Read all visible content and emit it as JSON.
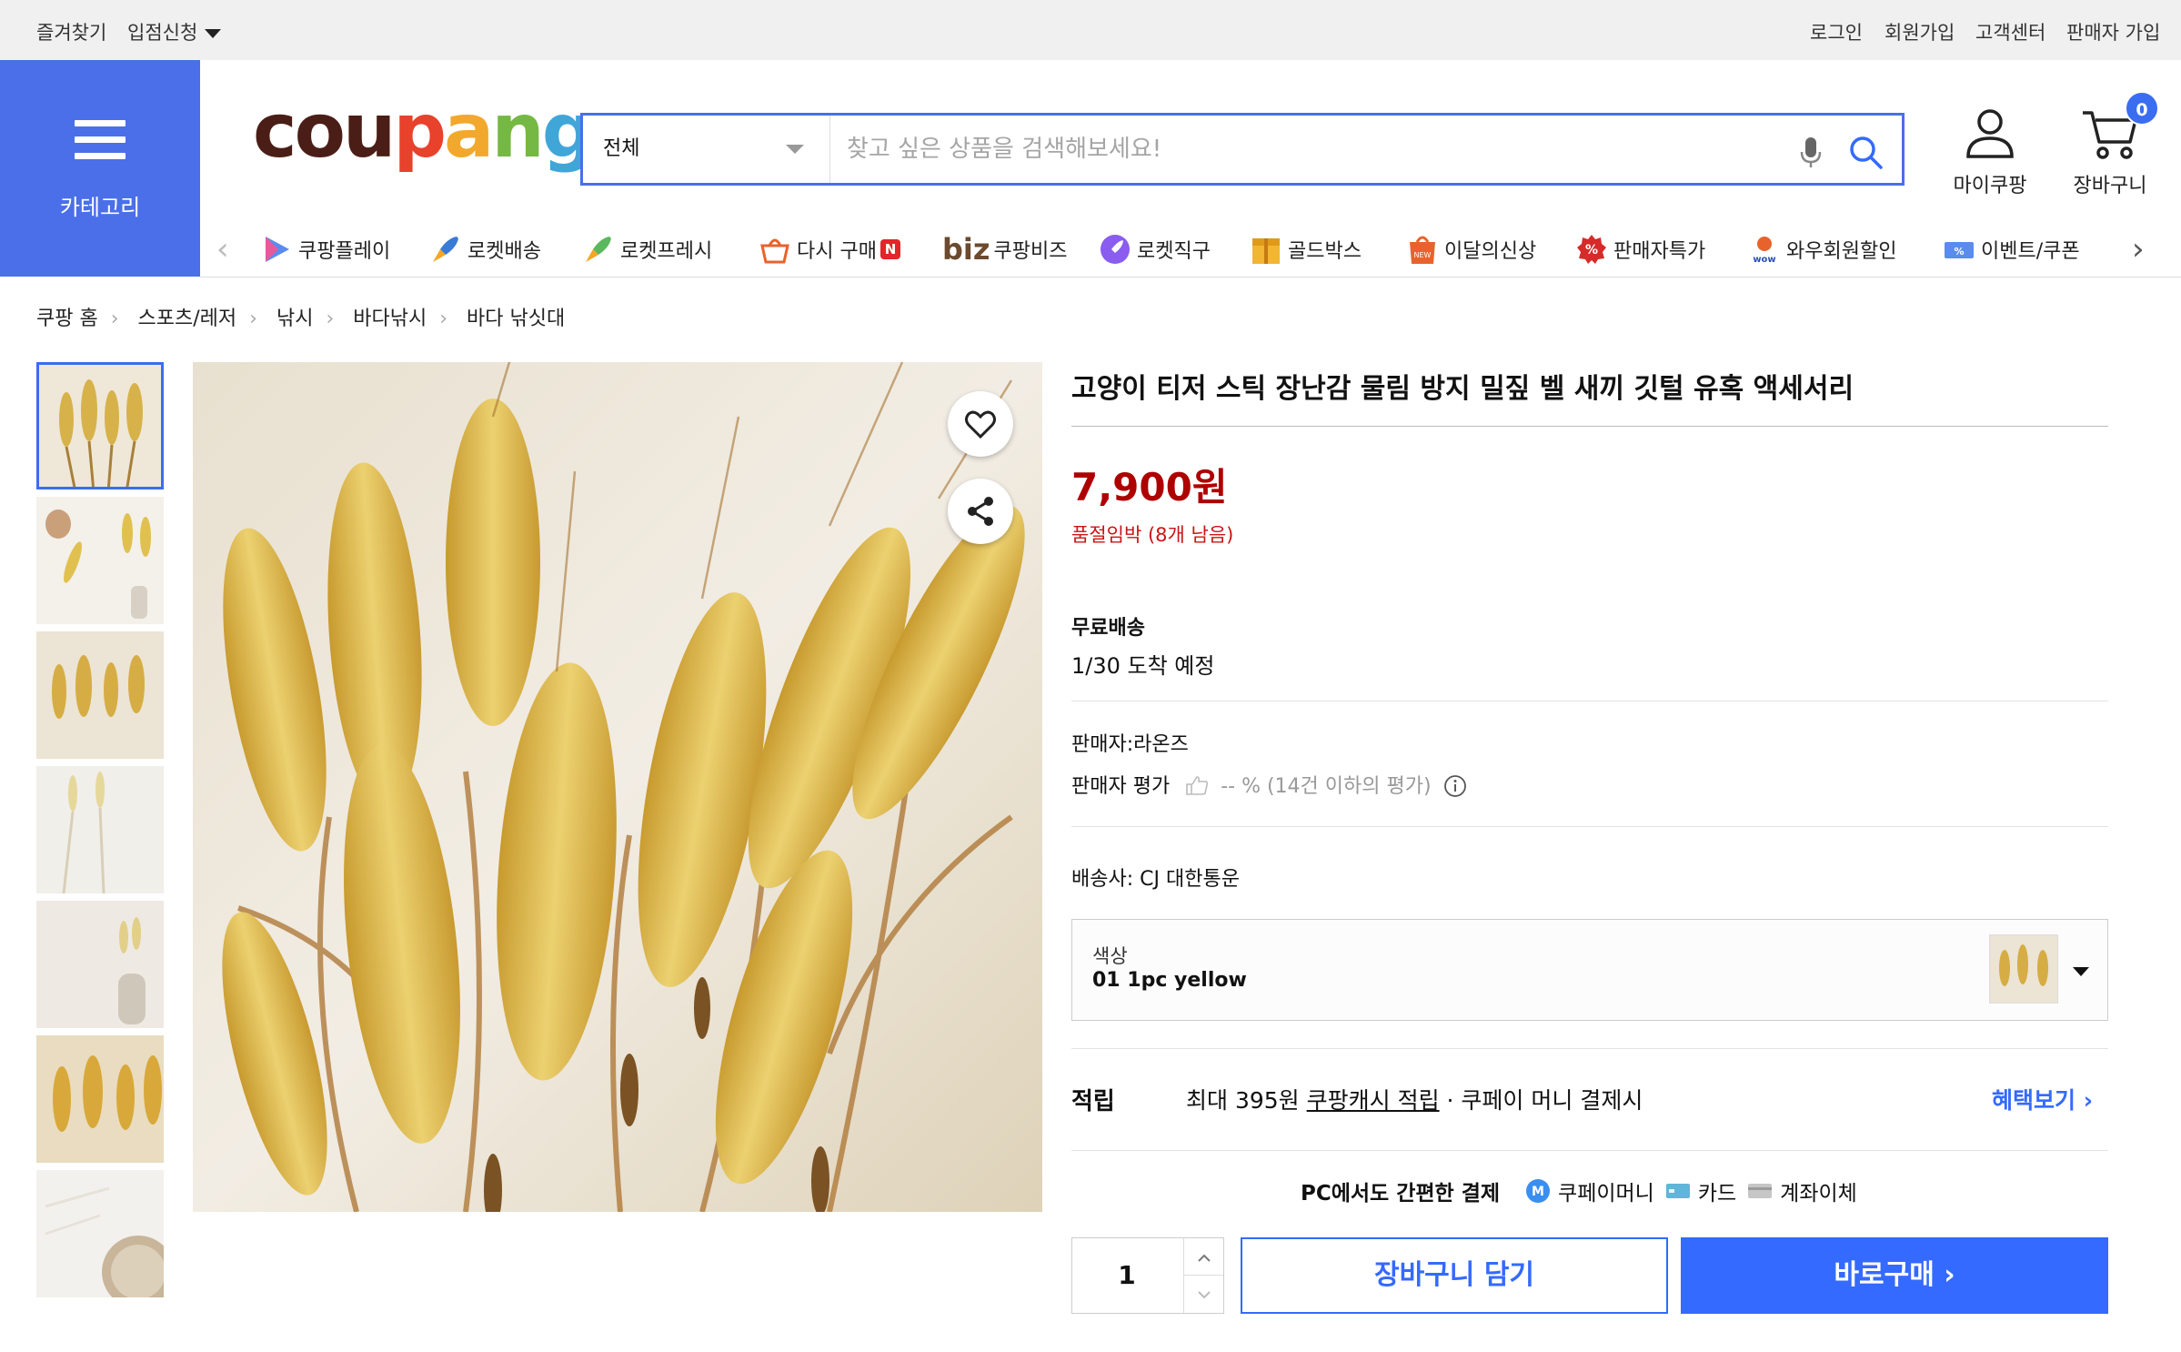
{
  "topbar": {
    "favorites": "즐겨찾기",
    "partner": "입점신청",
    "login": "로그인",
    "signup": "회원가입",
    "support": "고객센터",
    "seller_signup": "판매자 가입"
  },
  "header": {
    "category_label": "카테고리",
    "logo": {
      "p1": "cou",
      "p2": "p",
      "p3": "a",
      "p4": "n",
      "p5": "g"
    },
    "search_category": "전체",
    "search_placeholder": "찾고 싶은 상품을 검색해보세요!",
    "mycoupang": "마이쿠팡",
    "cart": "장바구니",
    "cart_count": "0"
  },
  "nav": {
    "items": [
      {
        "label": "쿠팡플레이",
        "icon": "play-icon"
      },
      {
        "label": "로켓배송",
        "icon": "rocket-icon"
      },
      {
        "label": "로켓프레시",
        "icon": "rocket-fresh-icon"
      },
      {
        "label": "다시 구매",
        "icon": "rebuy-icon",
        "badge": "N"
      },
      {
        "label": "쿠팡비즈",
        "icon": "biz-icon",
        "prefix": "biz"
      },
      {
        "label": "로켓직구",
        "icon": "rocket-global-icon"
      },
      {
        "label": "골드박스",
        "icon": "goldbox-icon"
      },
      {
        "label": "이달의신상",
        "icon": "new-icon"
      },
      {
        "label": "판매자특가",
        "icon": "seller-deal-icon"
      },
      {
        "label": "와우회원할인",
        "icon": "wow-icon"
      },
      {
        "label": "이벤트/쿠폰",
        "icon": "coupon-icon"
      }
    ]
  },
  "breadcrumb": [
    "쿠팡 홈",
    "스포츠/레저",
    "낚시",
    "바다낚시",
    "바다 낚싯대"
  ],
  "product": {
    "title": "고양이 티저 스틱 장난감 물림 방지 밀짚 벨 새끼 깃털 유혹 액세서리",
    "price": "7,900원",
    "stock": "품절임박 (8개 남음)",
    "shipping_title": "무료배송",
    "arrival": "1/30 도착 예정",
    "seller": "판매자:라온즈",
    "rating_label": "판매자 평가",
    "rating_value": "-- % (14건 이하의 평가)",
    "courier": "배송사:  CJ 대한통운",
    "option_label": "색상",
    "option_value": "01 1pc yellow",
    "reward_label": "적립",
    "reward_pre": "최대 395원 ",
    "reward_link": "쿠팡캐시 적립",
    "reward_post": " · 쿠페이 머니 결제시",
    "benefit": "혜택보기 ›",
    "pay_title": "PC에서도 간편한 결제",
    "pay_money": "쿠페이머니",
    "pay_card": "카드",
    "pay_bank": "계좌이체",
    "quantity": "1",
    "add_to_cart": "장바구니 담기",
    "buy_now": "바로구매 ›"
  },
  "colors": {
    "accent": "#346aff",
    "price": "#ae0000",
    "category_bg": "#4a6fe8"
  }
}
